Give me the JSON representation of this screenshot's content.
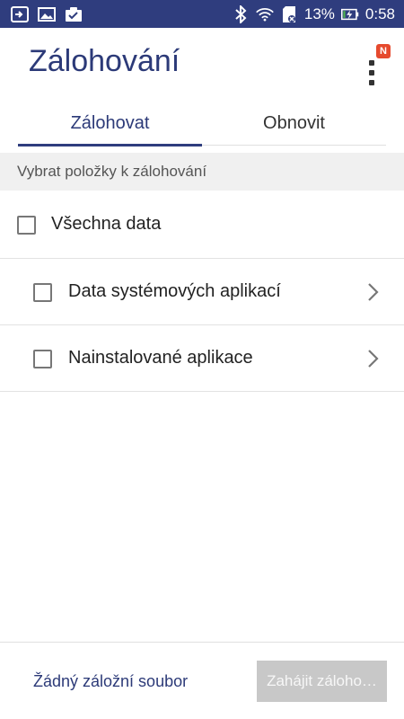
{
  "status_bar": {
    "battery_percent": "13%",
    "time": "0:58",
    "icons_left": [
      "screen-icon",
      "gallery-icon",
      "clipboard-check-icon"
    ],
    "icons_right": [
      "bluetooth-icon",
      "wifi-icon",
      "sd-card-icon",
      "battery-charging-icon"
    ]
  },
  "header": {
    "title": "Zálohování",
    "menu_badge": "N"
  },
  "tabs": [
    {
      "label": "Zálohovat",
      "active": true
    },
    {
      "label": "Obnovit",
      "active": false
    }
  ],
  "section": {
    "header": "Vybrat položky k zálohování"
  },
  "items": {
    "all": {
      "label": "Všechna data",
      "checked": false
    },
    "system_apps": {
      "label": "Data systémových aplikací",
      "checked": false
    },
    "installed_apps": {
      "label": "Nainstalované aplikace",
      "checked": false
    }
  },
  "footer": {
    "no_backup_label": "Žádný záložní soubor",
    "start_button_label": "Zahájit záloho…"
  },
  "colors": {
    "status_bar": "#2f3d7e",
    "accent": "#2c3a78",
    "badge": "#e64a2e",
    "disabled_button": "#c8c8c8"
  }
}
